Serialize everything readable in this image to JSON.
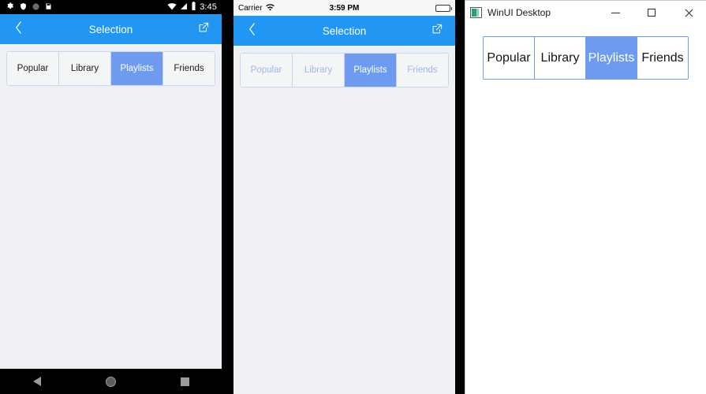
{
  "android": {
    "status_bar": {
      "icons": [
        "gear-icon",
        "shield-icon",
        "circle-icon",
        "sdcard-icon"
      ],
      "wifi_icon": "wifi-icon",
      "signal_icon": "cell-signal-icon",
      "battery_icon": "battery-icon",
      "clock": "3:45"
    },
    "app_bar": {
      "back_icon": "back-chevron-icon",
      "title": "Selection",
      "action_icon": "open-external-icon"
    },
    "segment": {
      "items": [
        {
          "label": "Popular",
          "selected": false
        },
        {
          "label": "Library",
          "selected": false
        },
        {
          "label": "Playlists",
          "selected": true
        },
        {
          "label": "Friends",
          "selected": false
        }
      ]
    },
    "nav_bar": {
      "back_label": "Back",
      "home_label": "Home",
      "recents_label": "Recents"
    }
  },
  "ios": {
    "status_bar": {
      "carrier": "Carrier",
      "wifi_icon": "wifi-icon",
      "time": "3:59 PM",
      "battery_icon": "battery-icon"
    },
    "nav_bar": {
      "back_icon": "back-chevron-icon",
      "title": "Selection",
      "action_icon": "open-external-icon"
    },
    "segment": {
      "items": [
        {
          "label": "Popular",
          "selected": false
        },
        {
          "label": "Library",
          "selected": false
        },
        {
          "label": "Playlists",
          "selected": true
        },
        {
          "label": "Friends",
          "selected": false
        }
      ]
    }
  },
  "winui": {
    "title_bar": {
      "app_icon": "winui-app-icon",
      "title": "WinUI Desktop",
      "minimize_label": "Minimize",
      "maximize_label": "Maximize",
      "close_label": "Close"
    },
    "segment": {
      "items": [
        {
          "label": "Popular",
          "selected": false
        },
        {
          "label": "Library",
          "selected": false
        },
        {
          "label": "Playlists",
          "selected": true
        },
        {
          "label": "Friends",
          "selected": false
        }
      ]
    }
  },
  "colors": {
    "accent_blue": "#2196F3",
    "selected_tab": "#6E9BF0",
    "segment_border": "#C7D7F2",
    "winui_border": "#6E9BF0",
    "mobile_background": "#EFF0F4",
    "ios_label": "#9FB6E8"
  }
}
